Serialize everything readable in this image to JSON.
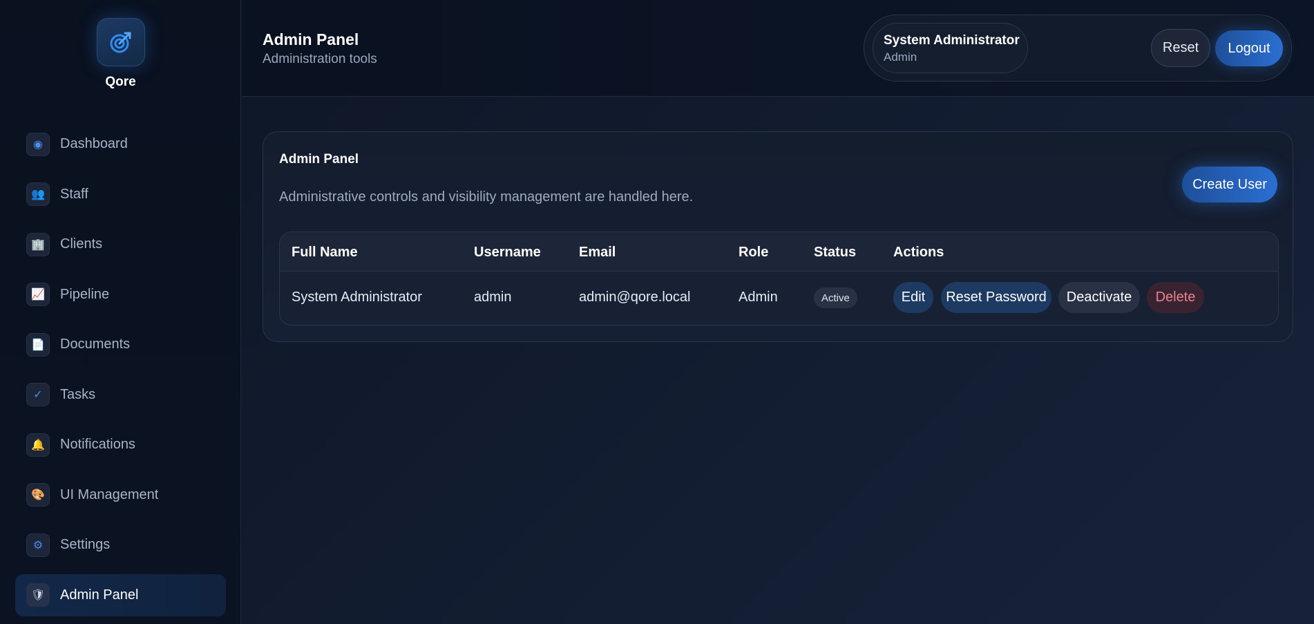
{
  "brand": {
    "name": "Qore",
    "logo_icon": "target-arrow-icon",
    "accent": "#2b6fd1"
  },
  "sidebar": {
    "items": [
      {
        "label": "Dashboard",
        "icon": "◉",
        "icon_name": "dashboard-icon"
      },
      {
        "label": "Staff",
        "icon": "👥",
        "icon_name": "staff-icon"
      },
      {
        "label": "Clients",
        "icon": "🏢",
        "icon_name": "clients-icon"
      },
      {
        "label": "Pipeline",
        "icon": "📈",
        "icon_name": "pipeline-icon"
      },
      {
        "label": "Documents",
        "icon": "📄",
        "icon_name": "documents-icon"
      },
      {
        "label": "Tasks",
        "icon": "✓",
        "icon_name": "tasks-icon"
      },
      {
        "label": "Notifications",
        "icon": "🔔",
        "icon_name": "notifications-icon"
      },
      {
        "label": "UI Management",
        "icon": "🎨",
        "icon_name": "ui-management-icon"
      },
      {
        "label": "Settings",
        "icon": "⚙",
        "icon_name": "settings-icon"
      },
      {
        "label": "Admin Panel",
        "icon": "🛡",
        "icon_name": "admin-panel-icon",
        "active": true
      }
    ]
  },
  "header": {
    "title": "Admin Panel",
    "subtitle": "Administration tools",
    "user": {
      "name": "System Administrator",
      "role": "Admin"
    },
    "reset_label": "Reset",
    "logout_label": "Logout"
  },
  "card": {
    "title": "Admin Panel",
    "description": "Administrative controls and visibility management are handled here.",
    "create_label": "Create User",
    "table": {
      "columns": [
        "Full Name",
        "Username",
        "Email",
        "Role",
        "Status",
        "Actions"
      ],
      "rows": [
        {
          "full_name": "System Administrator",
          "username": "admin",
          "email": "admin@qore.local",
          "role": "Admin",
          "status": "Active",
          "actions": {
            "edit": "Edit",
            "reset_password": "Reset Password",
            "deactivate": "Deactivate",
            "delete": "Delete"
          }
        }
      ]
    }
  }
}
